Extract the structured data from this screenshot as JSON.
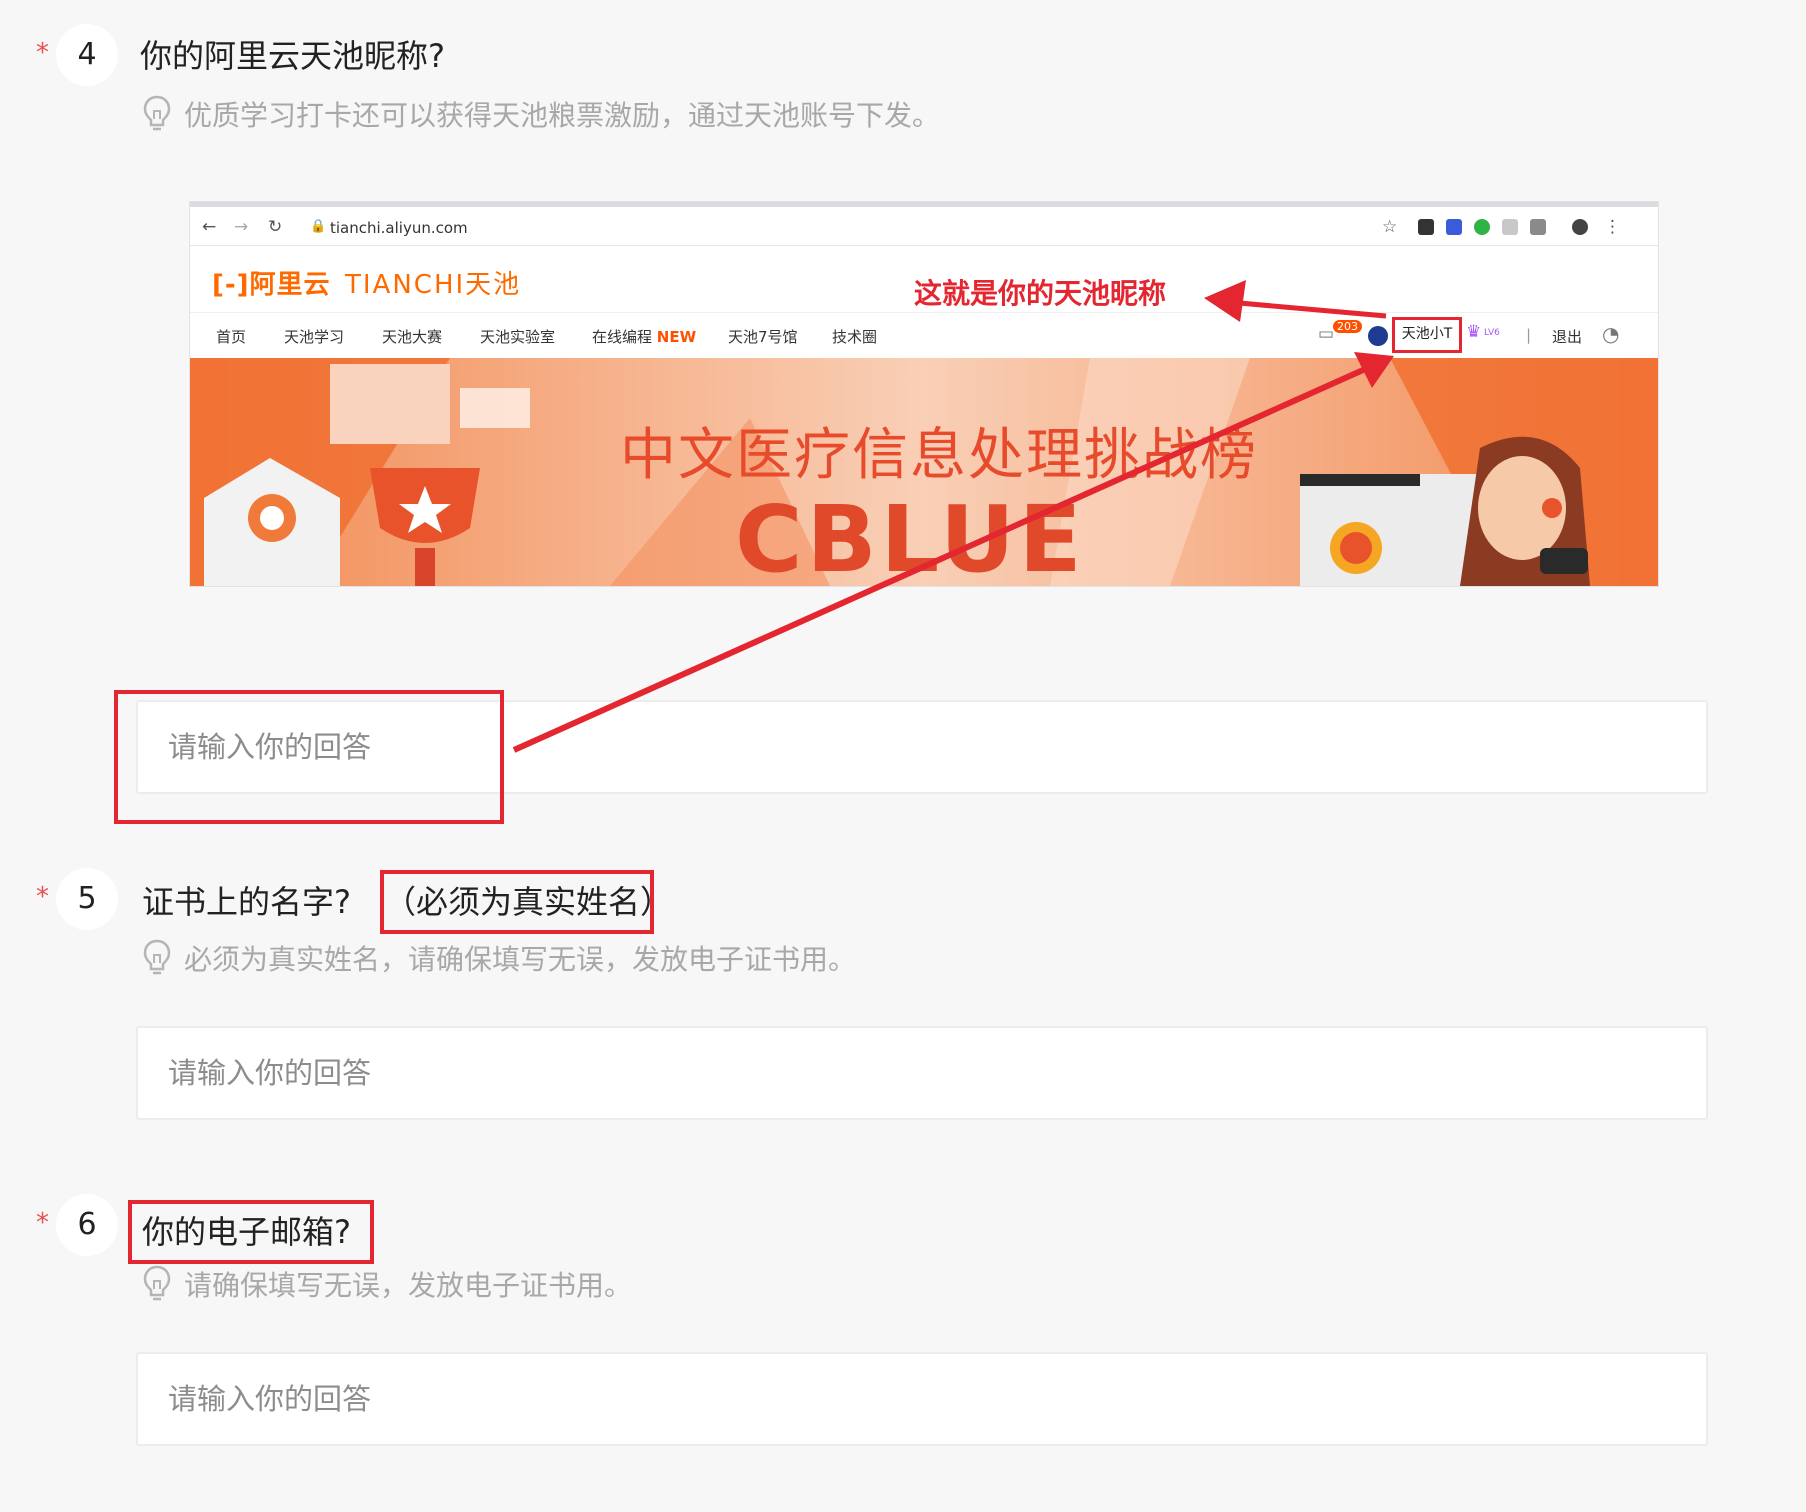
{
  "questions": [
    {
      "required_mark": "*",
      "number": "4",
      "title": "你的阿里云天池昵称?",
      "hint": "优质学习打卡还可以获得天池粮票激励，通过天池账号下发。",
      "answer_placeholder": "请输入你的回答"
    },
    {
      "required_mark": "*",
      "number": "5",
      "title": "证书上的名字?",
      "title_note": "（必须为真实姓名）",
      "hint": "必须为真实姓名，请确保填写无误，发放电子证书用。",
      "answer_placeholder": "请输入你的回答"
    },
    {
      "required_mark": "*",
      "number": "6",
      "title": "你的电子邮箱?",
      "hint": "请确保填写无误，发放电子证书用。",
      "answer_placeholder": "请输入你的回答"
    }
  ],
  "screenshot": {
    "url": "tianchi.aliyun.com",
    "logo_aliyun": "[-]阿里云",
    "logo_tianchi": "TIANCHI天池",
    "callout": "这就是你的天池昵称",
    "nav_items": [
      "首页",
      "天池学习",
      "天池大赛",
      "天池实验室",
      "在线编程",
      "天池7号馆",
      "技术圈"
    ],
    "nav_new_tag": "NEW",
    "message_count": "203",
    "username": "天池小T",
    "level": "LV6",
    "divider": "|",
    "logout": "退出",
    "banner_title": "中文医疗信息处理挑战榜",
    "banner_subtitle": "CBLUE"
  },
  "colors": {
    "highlight_red": "#e3262f",
    "brand_orange": "#ff6a00",
    "page_bg": "#f7f7f7"
  }
}
